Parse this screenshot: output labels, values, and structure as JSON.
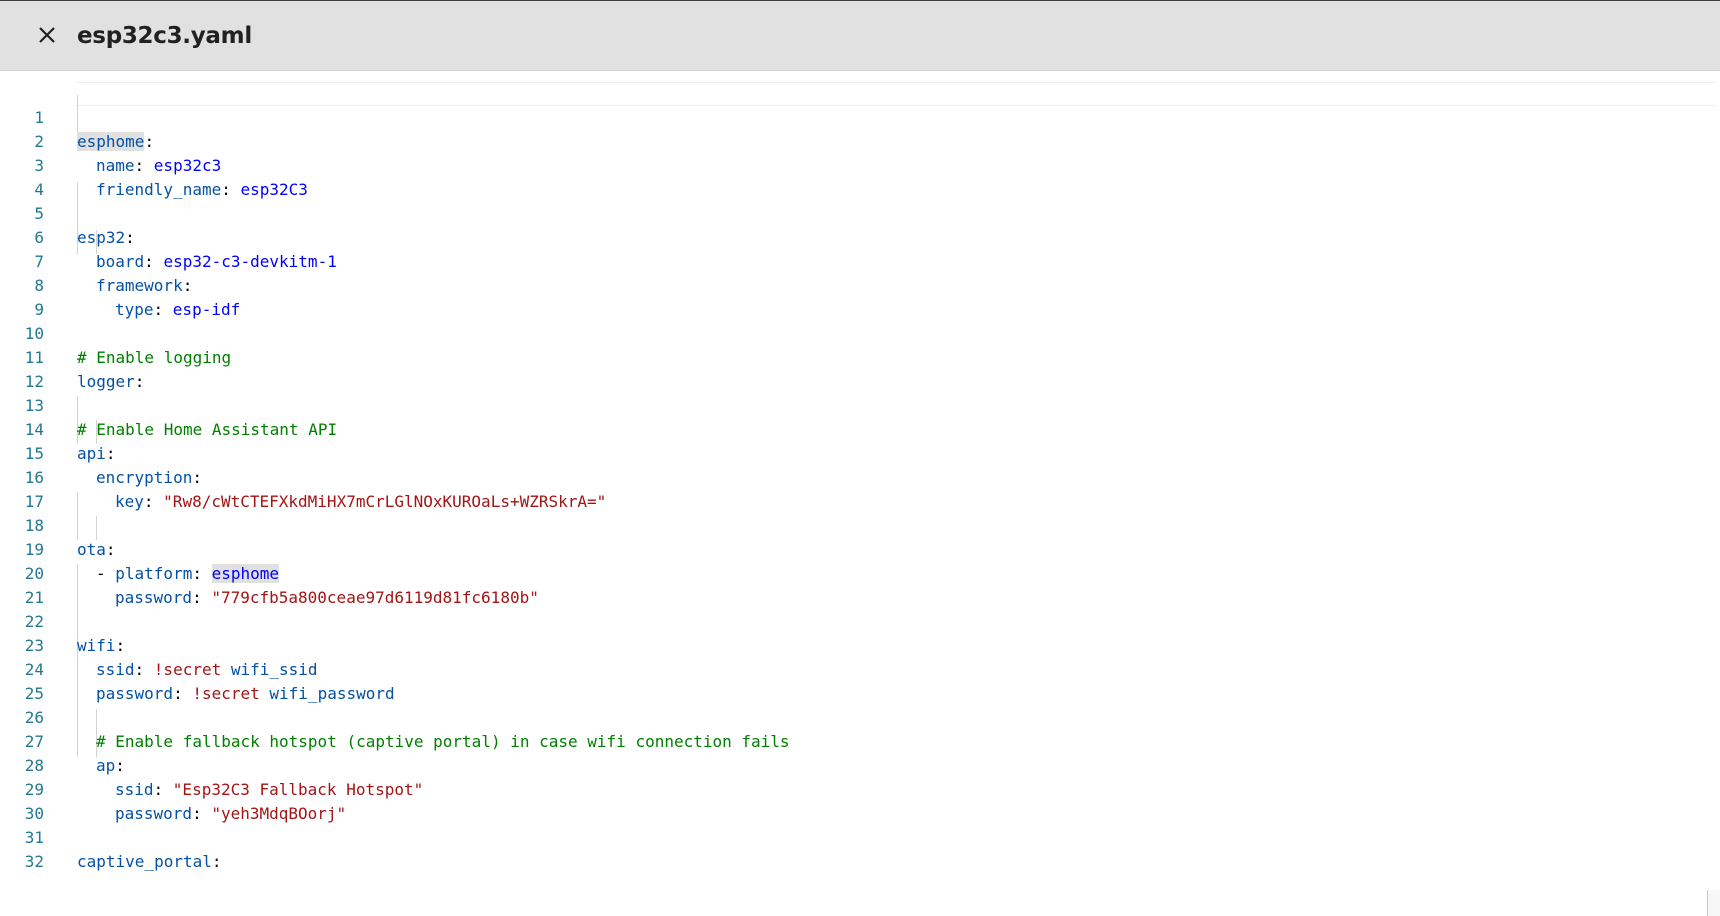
{
  "header": {
    "title": "esp32c3.yaml",
    "close_icon": "close-icon"
  },
  "editor": {
    "line_numbers": [
      "1",
      "2",
      "3",
      "4",
      "5",
      "6",
      "7",
      "8",
      "9",
      "10",
      "11",
      "12",
      "13",
      "14",
      "15",
      "16",
      "17",
      "18",
      "19",
      "20",
      "21",
      "22",
      "23",
      "24",
      "25",
      "26",
      "27",
      "28",
      "29",
      "30",
      "31",
      "32"
    ],
    "lines": {
      "l1": {
        "key": "esphome",
        "punct": ":"
      },
      "l2": {
        "key": "name",
        "punct": ": ",
        "value": "esp32c3"
      },
      "l3": {
        "key": "friendly_name",
        "punct": ": ",
        "value": "esp32C3"
      },
      "l5": {
        "key": "esp32",
        "punct": ":"
      },
      "l6": {
        "key": "board",
        "punct": ": ",
        "value": "esp32-c3-devkitm-1"
      },
      "l7": {
        "key": "framework",
        "punct": ":"
      },
      "l8": {
        "key": "type",
        "punct": ": ",
        "value": "esp-idf"
      },
      "l10": {
        "comment": "# Enable logging"
      },
      "l11": {
        "key": "logger",
        "punct": ":"
      },
      "l13": {
        "comment": "# Enable Home Assistant API"
      },
      "l14": {
        "key": "api",
        "punct": ":"
      },
      "l15": {
        "key": "encryption",
        "punct": ":"
      },
      "l16": {
        "key": "key",
        "punct": ": ",
        "string": "\"Rw8/cWtCTEFXkdMiHX7mCrLGlNOxKUROaLs+WZRSkrA=\""
      },
      "l18": {
        "key": "ota",
        "punct": ":"
      },
      "l19": {
        "dash": "- ",
        "key": "platform",
        "punct": ": ",
        "value": "esphome"
      },
      "l20": {
        "key": "password",
        "punct": ": ",
        "string": "\"779cfb5a800ceae97d6119d81fc6180b\""
      },
      "l22": {
        "key": "wifi",
        "punct": ":"
      },
      "l23": {
        "key": "ssid",
        "punct": ": ",
        "tag": "!secret",
        "value": " wifi_ssid"
      },
      "l24": {
        "key": "password",
        "punct": ": ",
        "tag": "!secret",
        "value": " wifi_password"
      },
      "l26": {
        "comment": "# Enable fallback hotspot (captive portal) in case wifi connection fails"
      },
      "l27": {
        "key": "ap",
        "punct": ":"
      },
      "l28": {
        "key": "ssid",
        "punct": ": ",
        "string": "\"Esp32C3 Fallback Hotspot\""
      },
      "l29": {
        "key": "password",
        "punct": ": ",
        "string": "\"yeh3MdqBOorj\""
      },
      "l31": {
        "key": "captive_portal",
        "punct": ":"
      }
    }
  },
  "colors": {
    "line_number": "#237893",
    "key": "#0451a5",
    "value": "#0000ff",
    "string": "#a31515",
    "comment": "#008000",
    "header_bg": "#e1e1e1"
  }
}
